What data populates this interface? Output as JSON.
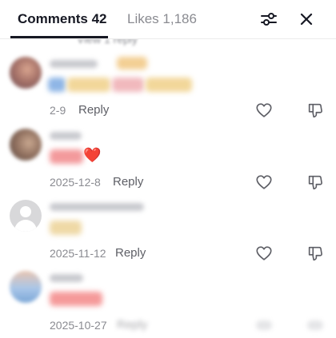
{
  "header": {
    "tabs": [
      {
        "label": "Comments 42",
        "active": true
      },
      {
        "label": "Likes 1,186",
        "active": false
      }
    ],
    "filter_icon": "sliders-icon",
    "close_icon": "close-icon"
  },
  "list": {
    "top_remnant": "View 1 reply",
    "comments": [
      {
        "date": "2-9",
        "reply": "Reply",
        "emoji": ""
      },
      {
        "date": "2025-12-8",
        "reply": "Reply",
        "emoji": "❤️"
      },
      {
        "date": "2025-11-12",
        "reply": "Reply",
        "emoji": ""
      },
      {
        "date": "2025-10-27",
        "reply": "Reply",
        "emoji": ""
      }
    ]
  },
  "colors": {
    "text": "#161823",
    "muted": "#8a8b91",
    "divider": "#ececec"
  }
}
